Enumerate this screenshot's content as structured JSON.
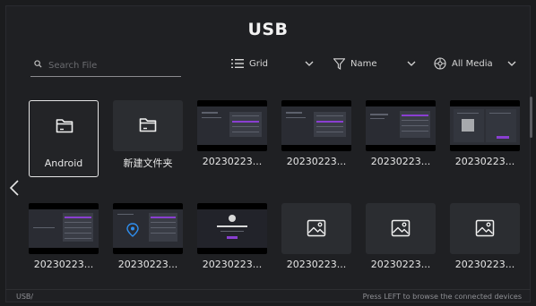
{
  "header": {
    "title": "USB"
  },
  "search": {
    "placeholder": "Search File",
    "value": ""
  },
  "toolbar": {
    "view": {
      "label": "Grid",
      "icon": "list-icon"
    },
    "sort": {
      "label": "Name",
      "icon": "filter-icon"
    },
    "media": {
      "label": "All Media",
      "icon": "media-icon"
    }
  },
  "grid": {
    "row1": [
      {
        "name": "Android",
        "kind": "folder",
        "selected": true
      },
      {
        "name": "新建文件夹",
        "kind": "folder"
      },
      {
        "name": "20230223...",
        "kind": "screenshot"
      },
      {
        "name": "20230223...",
        "kind": "screenshot"
      },
      {
        "name": "20230223...",
        "kind": "screenshot"
      },
      {
        "name": "20230223...",
        "kind": "screenshot"
      }
    ],
    "row2": [
      {
        "name": "20230223...",
        "kind": "screenshot"
      },
      {
        "name": "20230223...",
        "kind": "screenshot"
      },
      {
        "name": "20230223...",
        "kind": "screenshot"
      },
      {
        "name": "20230223...",
        "kind": "image"
      },
      {
        "name": "20230223...",
        "kind": "image"
      },
      {
        "name": "20230223...",
        "kind": "image"
      }
    ]
  },
  "footer": {
    "path": "USB/",
    "hint": "Press LEFT to browse the connected devices"
  },
  "colors": {
    "accent": "#8a3fd1",
    "background": "#1f2023",
    "tile": "#2b2d31"
  }
}
